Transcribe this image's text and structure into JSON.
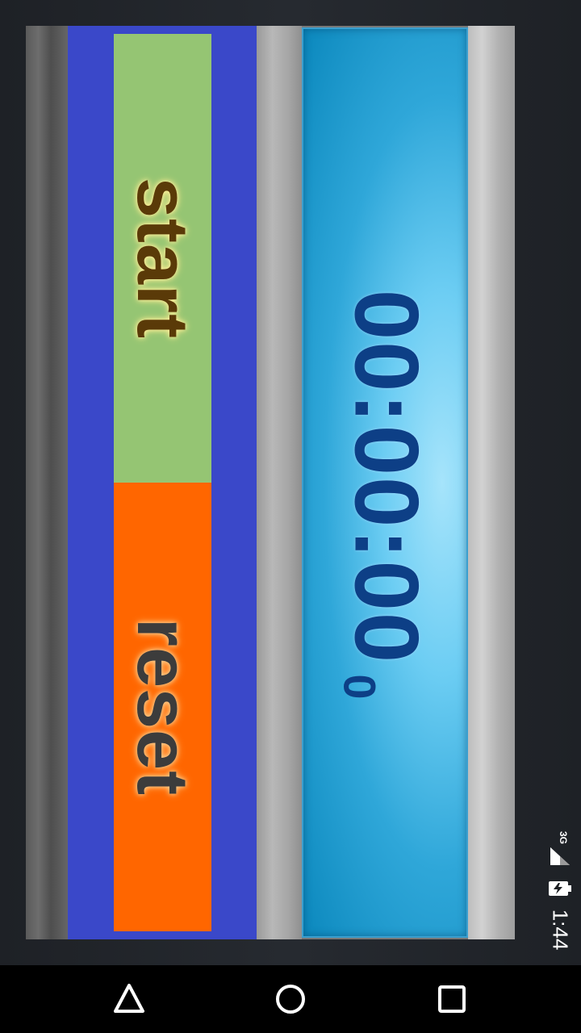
{
  "app": {
    "start_label": "start",
    "reset_label": "reset",
    "time_display": "00:00:00",
    "sub_display": "0",
    "colors": {
      "panel": "#3a48c9",
      "start_button": "#95c573",
      "reset_button": "#ff6600",
      "display_text": "#0d3f86",
      "display_bg": "#2fa7d9"
    }
  },
  "status_bar": {
    "network": "3G",
    "time": "1:44",
    "icons": [
      "signal-icon",
      "battery-charging-icon"
    ]
  },
  "nav_bar": {
    "icons": [
      "back-triangle-icon",
      "home-circle-icon",
      "recents-square-icon"
    ]
  }
}
